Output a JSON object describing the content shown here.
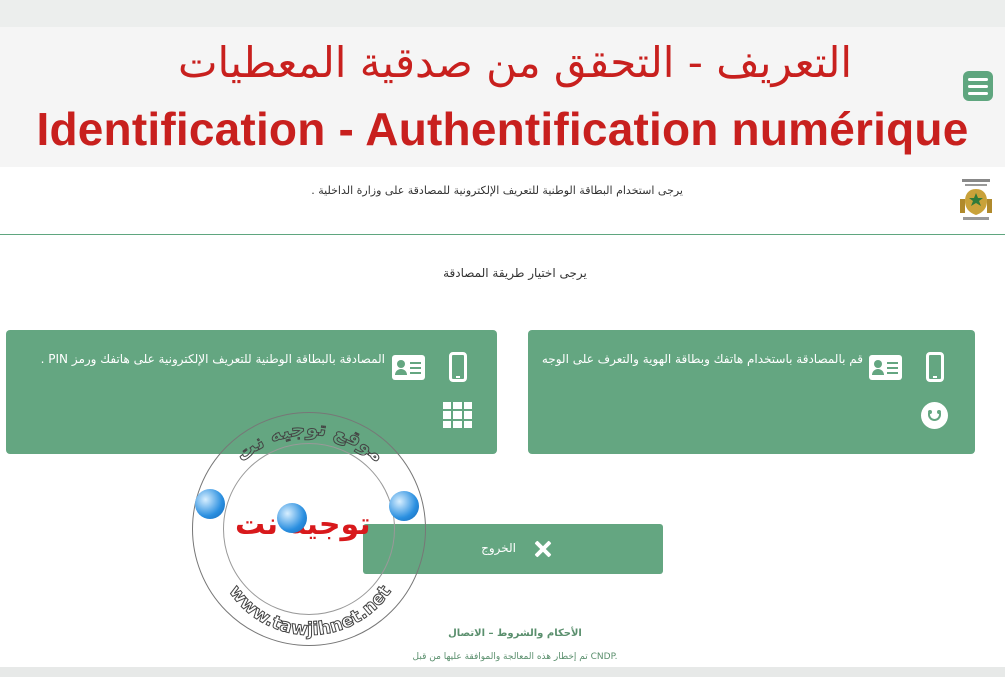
{
  "banner": {
    "title_ar": "التعريف - التحقق من صدقية المعطيات",
    "title_fr": "Identification - Authentification numérique"
  },
  "header": {
    "instruction": "يرجى استخدام البطاقة الوطنية للتعريف الإلكترونية للمصادقة على وزارة الداخلية ."
  },
  "main": {
    "method_prompt": "يرجى اختيار طريقة المصادقة",
    "cards": [
      {
        "text": "المصادقة بالبطاقة الوطنية للتعريف الإلكترونية على هاتفك ورمز PIN ."
      },
      {
        "text": "قم بالمصادقة باستخدام هاتفك وبطاقة الهوية والتعرف على الوجه"
      }
    ],
    "logout_label": "الخروج"
  },
  "footer": {
    "links": "الأحكام والشروط – الاتصال",
    "note": "تم إخطار هذه المعالجة والموافقة عليها من قبل CNDP."
  },
  "watermark": {
    "brand_ar": "توجيه نت",
    "ring_top": "موقع توجيه نت",
    "ring_bottom": "www.tawjihnet.net"
  },
  "colors": {
    "banner_text": "#c8201e",
    "card_green": "#64a681",
    "footer_text": "#5a8f6d"
  },
  "icons": [
    "menu-icon",
    "crest-icon",
    "phone-icon",
    "id-card-icon",
    "keypad-icon",
    "face-icon",
    "close-icon"
  ]
}
